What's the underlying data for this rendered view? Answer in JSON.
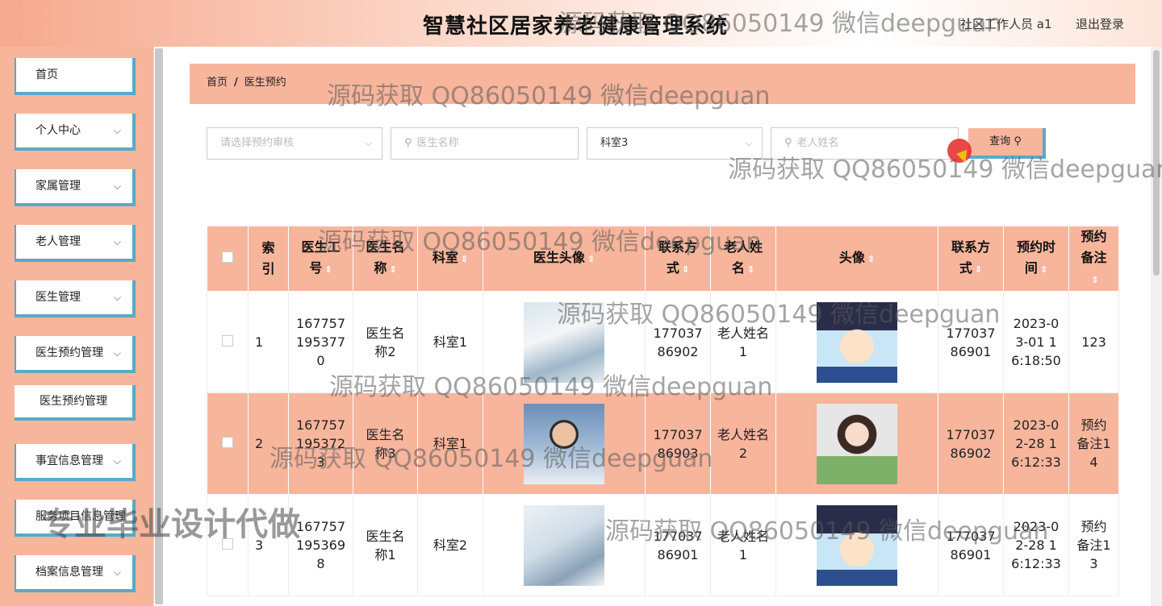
{
  "header": {
    "title": "智慧社区居家养老健康管理系统",
    "user": "社区工作人员 a1",
    "logout": "退出登录"
  },
  "sidebar": {
    "items": [
      {
        "label": "首页",
        "chevron": ""
      },
      {
        "label": "个人中心",
        "chevron": "⌵"
      },
      {
        "label": "家属管理",
        "chevron": "⌵"
      },
      {
        "label": "老人管理",
        "chevron": "⌵"
      },
      {
        "label": "医生管理",
        "chevron": "⌵"
      },
      {
        "label": "医生预约管理",
        "chevron": "⌵"
      },
      {
        "label": "事宜信息管理",
        "chevron": "⌵"
      },
      {
        "label": "服务项目信息管理",
        "chevron": "⌵"
      },
      {
        "label": "档案信息管理",
        "chevron": "⌵"
      }
    ],
    "sub_item": "医生预约管理"
  },
  "breadcrumb": {
    "home": "首页",
    "sep": "/",
    "current": "医生预约"
  },
  "filters": {
    "audit_placeholder": "请选择预约审核",
    "doctor_placeholder": "医生名称",
    "dept_value": "科室3",
    "elder_placeholder": "老人姓名",
    "search_label": "查询"
  },
  "table": {
    "headers": [
      "索引",
      "医生工号",
      "医生名称",
      "科室",
      "医生头像",
      "联系方式",
      "老人姓名",
      "头像",
      "联系方式",
      "预约时间",
      "预约备注"
    ],
    "rows": [
      {
        "index": "1",
        "doc_no": "1677571953770",
        "doc_name": "医生名称2",
        "dept": "科室1",
        "doc_phone": "17703786902",
        "elder": "老人姓名1",
        "elder_phone": "17703786901",
        "time": "2023-03-01 16:18:50",
        "note": "123"
      },
      {
        "index": "2",
        "doc_no": "1677571953723",
        "doc_name": "医生名称3",
        "dept": "科室1",
        "doc_phone": "17703786903",
        "elder": "老人姓名2",
        "elder_phone": "17703786902",
        "time": "2023-02-28 16:12:33",
        "note": "预约备注14"
      },
      {
        "index": "3",
        "doc_no": "1677571953698",
        "doc_name": "医生名称1",
        "dept": "科室2",
        "doc_phone": "17703786901",
        "elder": "老人姓名1",
        "elder_phone": "17703786901",
        "time": "2023-02-28 16:12:33",
        "note": "预约备注13"
      }
    ]
  },
  "watermarks": {
    "w1": "源码获取 QQ86050149 微信deepguan",
    "big": "专业毕业设计代做"
  },
  "icons": {
    "search": "search-icon",
    "chevron": "chevron-down-icon",
    "sort": "sort-icon"
  },
  "colors": {
    "accent": "#f7b59c",
    "border": "#5aa9c9"
  }
}
